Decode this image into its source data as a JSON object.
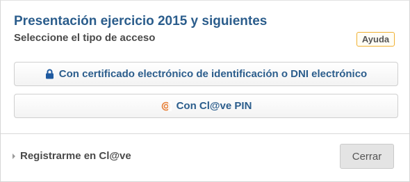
{
  "dialog": {
    "title": "Presentación ejercicio 2015 y siguientes",
    "subtitle": "Seleccione el tipo de acceso",
    "help_label": "Ayuda"
  },
  "access_options": [
    {
      "label": "Con certificado electrónico de identificación o DNI electrónico",
      "icon": "lock-icon"
    },
    {
      "label": "Con Cl@ve PIN",
      "icon": "clave-pin-icon"
    }
  ],
  "footer": {
    "register_label": "Registrarme en Cl@ve",
    "close_label": "Cerrar"
  },
  "colors": {
    "title": "#2b5d8c",
    "help_border": "#f0b030",
    "lock_icon": "#1f5aa0",
    "clave_icon": "#e8823a"
  }
}
